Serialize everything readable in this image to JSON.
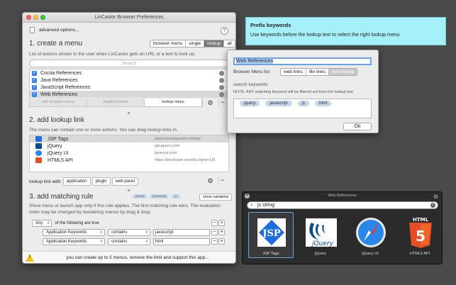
{
  "window": {
    "title": "LinCastor Browser Preferences"
  },
  "advanced": {
    "label": "advanced options..."
  },
  "help": "?",
  "section1": {
    "title": "1. create a menu",
    "desc": "List of actions shown to the user when LinCastor gets an URL or a text to look up.",
    "modes": [
      "browser menu",
      "single",
      "lookup",
      "all"
    ],
    "selected_mode": "lookup",
    "search_placeholder": "Search",
    "items": [
      {
        "label": "Cocoa References",
        "num": "1"
      },
      {
        "label": "Java References",
        "num": "2"
      },
      {
        "label": "JavaScript References",
        "num": "4"
      },
      {
        "label": "Web References",
        "num": "5"
      }
    ],
    "tabs": [
      "add browser menu",
      "single browser",
      "lookup menu"
    ],
    "active_tab": "lookup menu"
  },
  "section2": {
    "title": "2. add lookup link",
    "desc": "The menu can contain one or more actions. You can drag lookup links in.",
    "links": [
      {
        "label": "JSP Tags",
        "url": "www.tutorialspoint.com/jsp"
      },
      {
        "label": "jQuery",
        "url": "api.jquery.com"
      },
      {
        "label": "jQuery UI",
        "url": "jqueryui.com"
      },
      {
        "label": "HTML5 API",
        "url": "https://developer.mozilla.org/en-US"
      }
    ],
    "with_label": "lookup link with:",
    "buttons": [
      "application",
      "plugin",
      "web panel"
    ]
  },
  "section3": {
    "title": "3. add matching rule",
    "tokens": [
      "jquery",
      "javascript",
      "js"
    ],
    "show_variables": "show variables",
    "desc": "Show menu or launch app only if this rule applies. The first matching rule wins. The evaluation order may be changed by reordering menus by drag & drop.",
    "any": "Any",
    "following": "of the following are true",
    "rules": [
      {
        "field": "Application Keywords",
        "op": "contains",
        "value": "javascript"
      },
      {
        "field": "Application Keywords",
        "op": "contains",
        "value": "html"
      }
    ]
  },
  "footer": {
    "text": "you can create up to 5 menus, remove the limit and support this app..."
  },
  "tooltip": {
    "title": "Prefix keywords",
    "body": "Use keywords before the lookup text to select the right lookup menu"
  },
  "dialog": {
    "name": "Web References",
    "browser_menu_for": "Browser Menu for:",
    "menu_modes": [
      "web links",
      "file links",
      "text lookup"
    ],
    "selected_menu_mode": "text lookup",
    "search_keywords": "search keywords",
    "note": "NOTE: ANY matching keyword will be filtered out from the lookup text",
    "keywords": [
      "jquery",
      "javascript",
      "js",
      "html"
    ],
    "ok": "Ok"
  },
  "hud": {
    "title": "Web References",
    "search_value": "js string",
    "results": [
      {
        "label": "JSP Tags",
        "icon": "jsp-icon"
      },
      {
        "label": "jQuery",
        "icon": "jquery-icon"
      },
      {
        "label": "jQuery UI",
        "icon": "safari-icon"
      },
      {
        "label": "HTML5 API",
        "icon": "html5-icon"
      }
    ]
  },
  "colors": {
    "accent": "#3b82f6",
    "tooltip_bg": "#a6f1f8",
    "hud_bg": "#2b2b2b"
  }
}
